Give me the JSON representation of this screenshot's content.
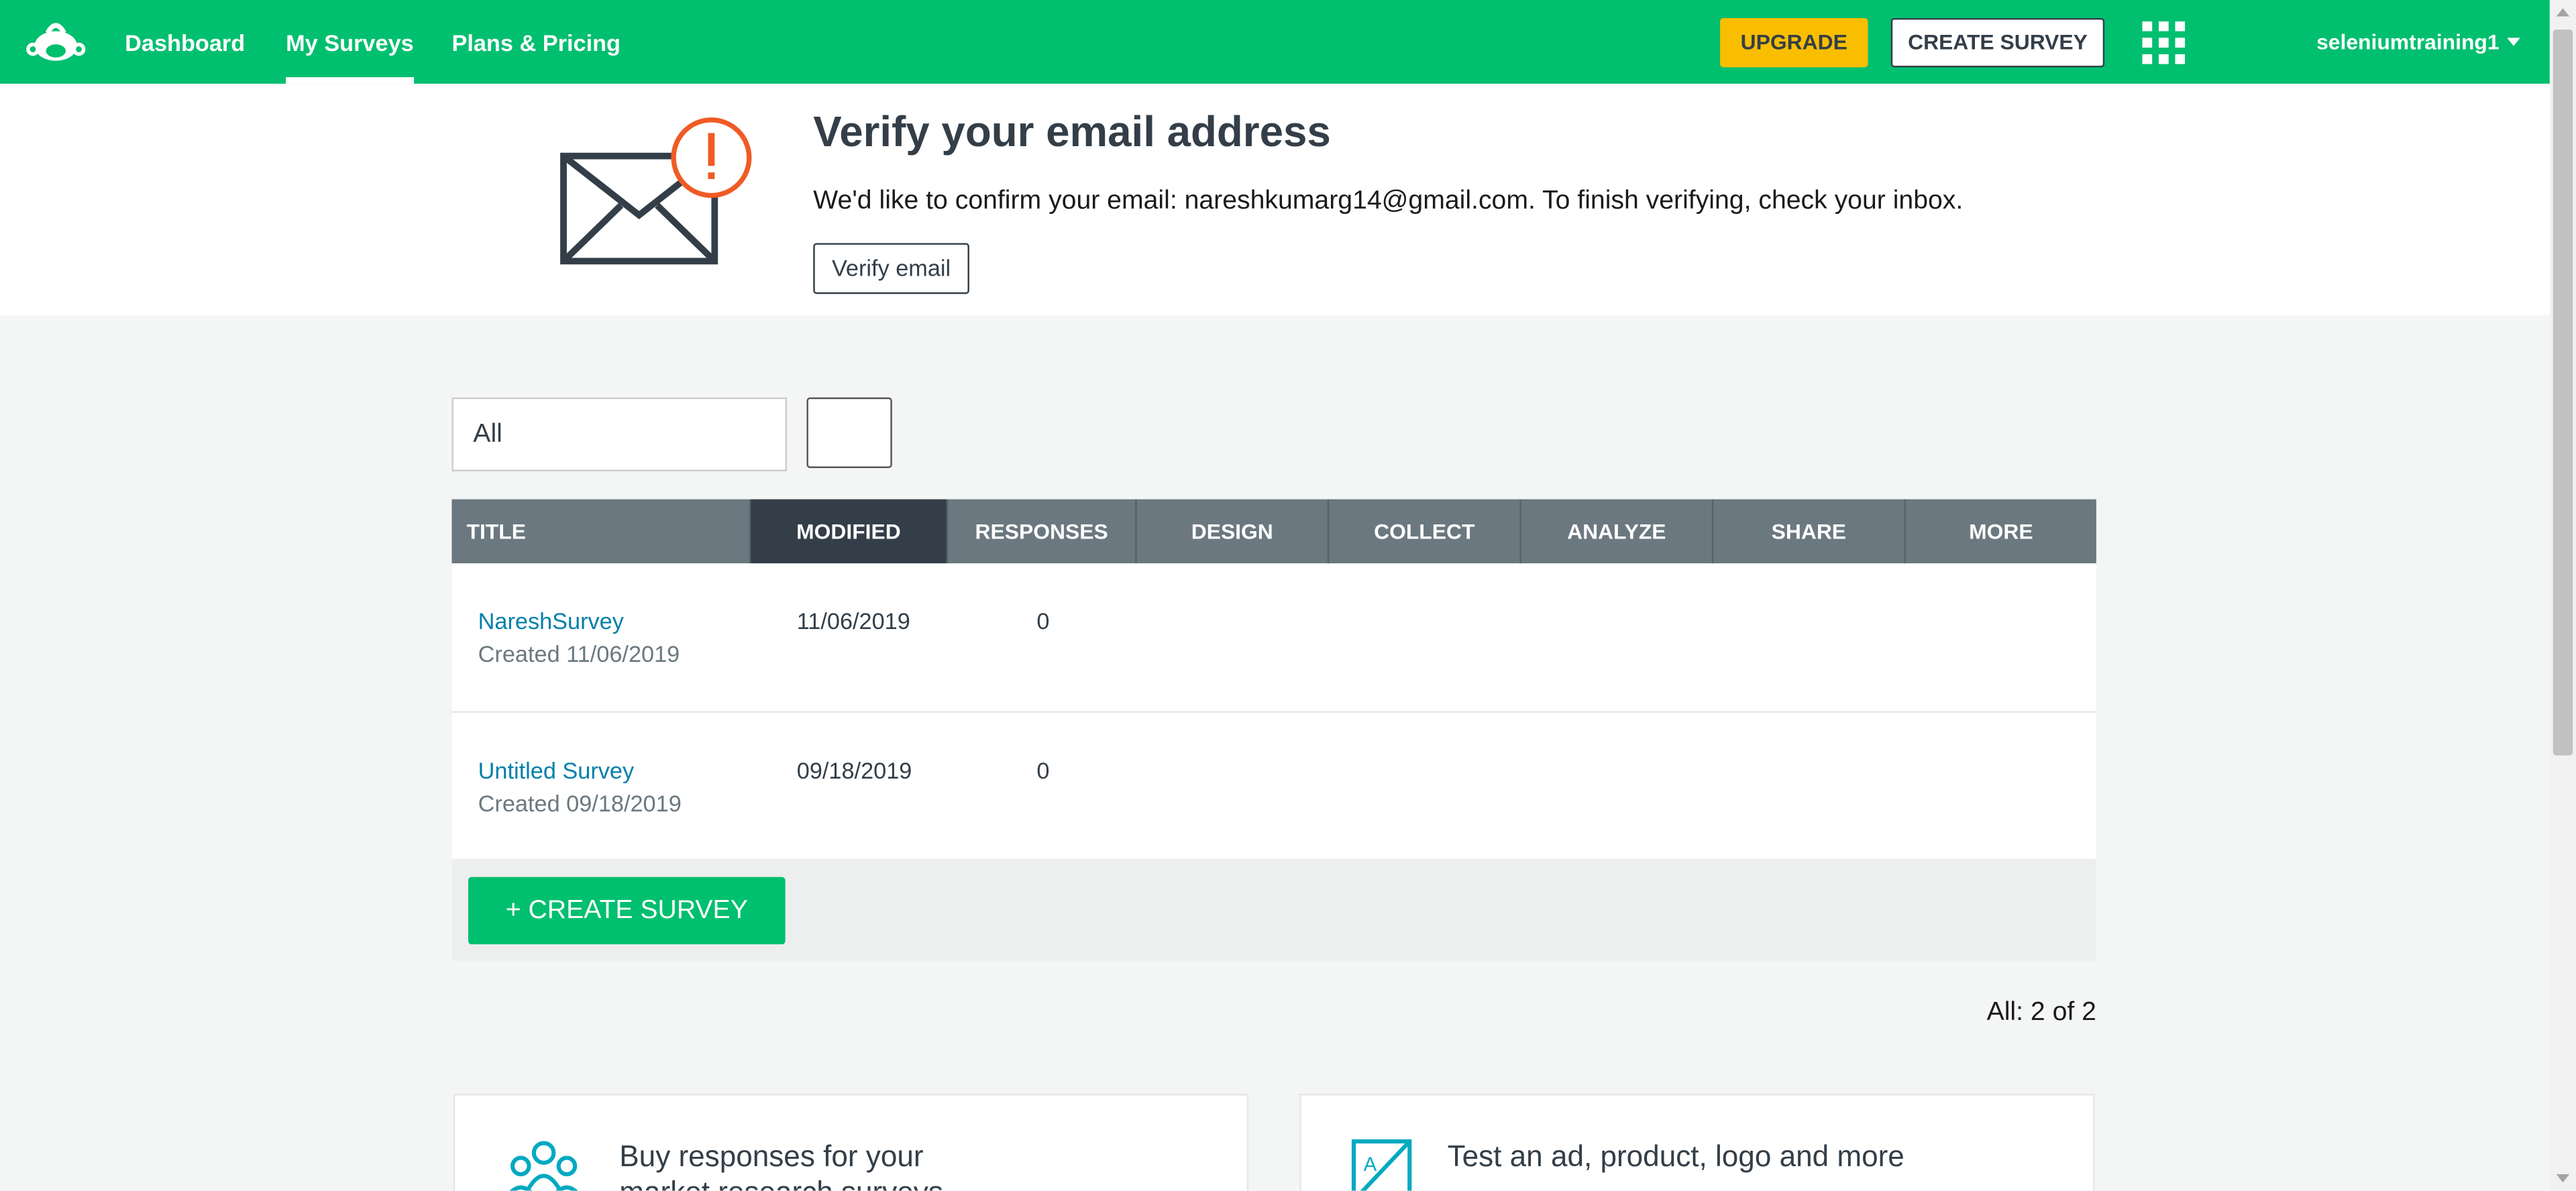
{
  "header": {
    "nav": [
      {
        "label": "Dashboard"
      },
      {
        "label": "My Surveys"
      },
      {
        "label": "Plans & Pricing"
      }
    ],
    "upgrade_label": "UPGRADE",
    "create_label": "CREATE SURVEY",
    "username": "seleniumtraining1",
    "brand_color": "#00bf6f"
  },
  "verify": {
    "title": "Verify your email address",
    "message": "We'd like to confirm your email: nareshkumarg14@gmail.com. To finish verifying, check your inbox.",
    "button_label": "Verify email"
  },
  "filter": {
    "selected": "All"
  },
  "table": {
    "columns": [
      "TITLE",
      "MODIFIED",
      "RESPONSES",
      "DESIGN",
      "COLLECT",
      "ANALYZE",
      "SHARE",
      "MORE"
    ],
    "active_column": "MODIFIED",
    "rows": [
      {
        "title": "NareshSurvey",
        "created": "Created 11/06/2019",
        "modified": "11/06/2019",
        "responses": "0"
      },
      {
        "title": "Untitled Survey",
        "created": "Created 09/18/2019",
        "modified": "09/18/2019",
        "responses": "0"
      }
    ]
  },
  "create_button_label": "+ CREATE SURVEY",
  "count_label": "All: 2 of 2",
  "promos": [
    {
      "title_line1": "Buy responses for your",
      "title_line2": "market research surveys",
      "icon": "people-group-icon"
    },
    {
      "title_line1": "Test an ad, product, logo and more",
      "icon": "design-test-icon"
    }
  ]
}
